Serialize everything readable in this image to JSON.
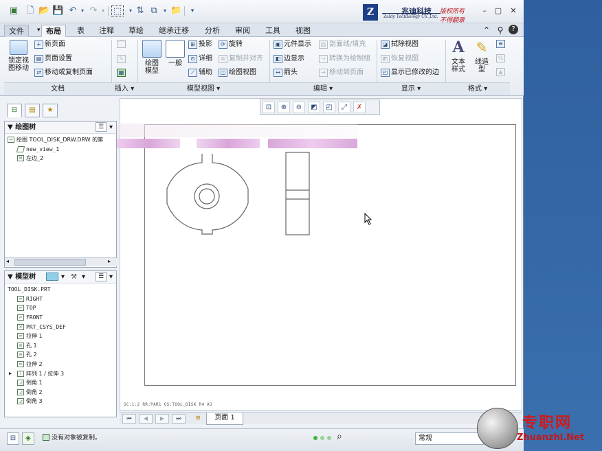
{
  "colors": {
    "accent": "#1d3f8a",
    "watermark_red": "#d01a1a",
    "blur_pink": "#d9a6d9",
    "desktop_blue": "#3a6aa8"
  },
  "titlebar": {
    "logo": {
      "mark": "Z",
      "name_cn": "兆迪科技",
      "name_en": "Zaldy Technology Co.,Ltd.",
      "slogan1": "版权所有",
      "slogan2": "不得翻录"
    },
    "window_buttons": [
      "minimize-icon",
      "restore-icon",
      "close-icon"
    ]
  },
  "tabs": [
    "文件",
    "布局",
    "表",
    "注释",
    "草绘",
    "继承迁移",
    "分析",
    "审阅",
    "工具",
    "视图"
  ],
  "ribbon": {
    "doc": {
      "lock": "锁定视\n图移动",
      "new_page": "新页面",
      "page_setup": "页面设置",
      "move_copy": "移动或复制页面",
      "label": "文档"
    },
    "insert": {
      "label": "插入"
    },
    "model_views": {
      "drawing_model": "绘图\n模型",
      "general": "一般",
      "projection": "投影",
      "detail": "详细",
      "auxiliary": "辅助",
      "revolve": "旋转",
      "copy_align": "复制并对齐",
      "drawing_view": "绘图视图",
      "label": "模型视图"
    },
    "edit": {
      "element_display": "元件显示",
      "edge_display": "边显示",
      "arrow": "箭头",
      "section_hatch": "剖面线/填充",
      "convert_group": "转换为绘制组",
      "move_page": "移动到页面",
      "label": "编辑"
    },
    "display": {
      "erase_view": "拭除视图",
      "restore_view": "恢复视图",
      "show_modified_edges": "显示已修改的边",
      "label": "显示"
    },
    "format": {
      "text_style": "文本\n样式",
      "line_type": "线造\n型",
      "label": "格式"
    }
  },
  "drawing_tree": {
    "title": "绘图树",
    "items": [
      {
        "label": "绘图 TOOL_DISK_DRW.DRW 的第",
        "indent": 0
      },
      {
        "label": "new_view_1",
        "indent": 1
      },
      {
        "label": "左边_2",
        "indent": 1
      }
    ]
  },
  "model_tree": {
    "title": "模型树",
    "root": "TOOL_DISK.PRT",
    "items": [
      {
        "label": "RIGHT",
        "icon": "datum-plane-icon"
      },
      {
        "label": "TOP",
        "icon": "datum-plane-icon"
      },
      {
        "label": "FRONT",
        "icon": "datum-plane-icon"
      },
      {
        "label": "PRT_CSYS_DEF",
        "icon": "csys-icon"
      },
      {
        "label": "拉伸 1",
        "icon": "extrude-icon"
      },
      {
        "label": "孔 1",
        "icon": "hole-icon"
      },
      {
        "label": "孔 2",
        "icon": "hole-icon"
      },
      {
        "label": "拉伸 2",
        "icon": "extrude-icon"
      },
      {
        "label": "阵列 1 / 拉伸 3",
        "icon": "pattern-icon"
      },
      {
        "label": "倒角 1",
        "icon": "chamfer-icon"
      },
      {
        "label": "倒角 2",
        "icon": "chamfer-icon"
      },
      {
        "label": "倒角 3",
        "icon": "chamfer-icon"
      }
    ]
  },
  "drawing_status": "SC:1:2    RR:PAR1    GS:TOOL_DISK    R4 A3",
  "page_nav": {
    "page_label": "页面 1"
  },
  "statusbar": {
    "message": "没有对象被复制。",
    "filter": "常规"
  },
  "watermark": {
    "cn": "专职网",
    "en": "Zhuanzhi.Net"
  }
}
